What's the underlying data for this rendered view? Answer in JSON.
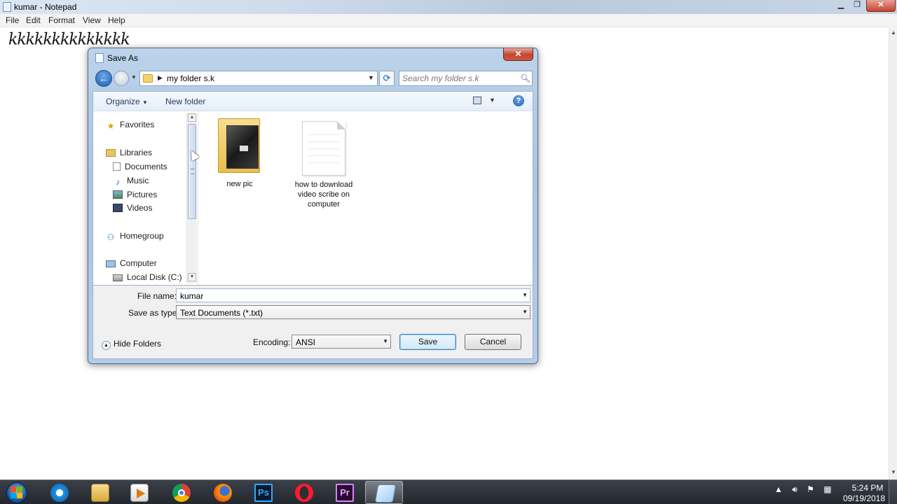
{
  "notepad": {
    "title": "kumar - Notepad",
    "menu": [
      "File",
      "Edit",
      "Format",
      "View",
      "Help"
    ],
    "content": "kkkkkkkkkkkkkk",
    "minimize_glyph": "▁",
    "maximize_glyph": "❐",
    "close_glyph": "✕"
  },
  "dialog": {
    "title": "Save As",
    "close_glyph": "✕",
    "address": {
      "crumb": "my folder s.k"
    },
    "search": {
      "placeholder": "Search my folder s.k"
    },
    "toolbar": {
      "organize": "Organize",
      "new_folder": "New folder",
      "help_glyph": "?"
    },
    "nav": {
      "favorites": "Favorites",
      "libraries": "Libraries",
      "documents": "Documents",
      "music": "Music",
      "pictures": "Pictures",
      "videos": "Videos",
      "homegroup": "Homegroup",
      "computer": "Computer",
      "local_disk": "Local Disk (C:)"
    },
    "files": [
      {
        "name": "new pic",
        "type": "folder-icon"
      },
      {
        "name": "how to download video scribe on computer",
        "type": "text-document-icon"
      }
    ],
    "file_name_label": "File name:",
    "file_name_value": "kumar",
    "save_as_type_label": "Save as type:",
    "save_as_type_value": "Text Documents (*.txt)",
    "encoding_label": "Encoding:",
    "encoding_value": "ANSI",
    "hide_folders": "Hide Folders",
    "save_button": "Save",
    "cancel_button": "Cancel"
  },
  "taskbar": {
    "apps": [
      "internet-explorer-icon",
      "file-explorer-icon",
      "media-player-icon",
      "chrome-icon",
      "firefox-icon",
      "photoshop-icon",
      "opera-icon",
      "premiere-icon",
      "notepad-icon"
    ],
    "photoshop_label": "Ps",
    "premiere_label": "Pr",
    "time": "5:24 PM",
    "date": "09/19/2018"
  },
  "colors": {
    "accent": "#1d5fb7",
    "dialog_frame": "#aac6e2",
    "taskbar": "#2b3038"
  }
}
